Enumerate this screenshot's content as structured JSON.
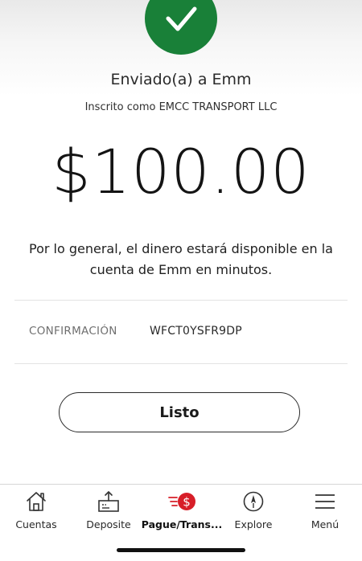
{
  "success": {
    "icon": "checkmark-icon",
    "color": "#198038"
  },
  "confirmation_screen": {
    "sent_to": "Enviado(a) a Emm",
    "enrolled_as": "Inscrito como EMCC TRANSPORT LLC",
    "amount": "$100.00",
    "availability_note": "Por lo general, el dinero estará disponible en la cuenta de Emm en minutos.",
    "confirmation_label": "CONFIRMACIÓN",
    "confirmation_code": "WFCT0YSFR9DP",
    "done_button_label": "Listo"
  },
  "tab_bar": {
    "accent_color": "#d71e28",
    "tabs": [
      {
        "label": "Cuentas",
        "icon": "home-icon",
        "active": false
      },
      {
        "label": "Deposite",
        "icon": "deposit-icon",
        "active": false
      },
      {
        "label": "Pague/Trans...",
        "icon": "pay-transfer-icon",
        "active": true
      },
      {
        "label": "Explore",
        "icon": "compass-icon",
        "active": false
      },
      {
        "label": "Menú",
        "icon": "menu-icon",
        "active": false
      }
    ]
  }
}
